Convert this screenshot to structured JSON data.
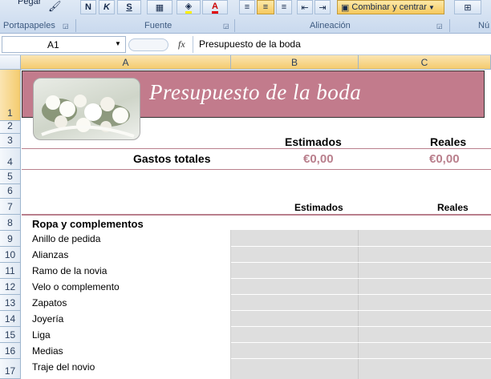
{
  "ribbon": {
    "paste_label": "Pegar",
    "bold": "N",
    "italic": "K",
    "underline": "S",
    "font_color_letter": "A",
    "merge_label": "Combinar y centrar",
    "groups": {
      "clipboard": "Portapapeles",
      "font": "Fuente",
      "alignment": "Alineación",
      "number": "Nú"
    }
  },
  "formula_bar": {
    "cell_ref": "A1",
    "fx": "fx",
    "content": "Presupuesto de la boda"
  },
  "columns": [
    "A",
    "B",
    "C"
  ],
  "rows": [
    "1",
    "2",
    "3",
    "4",
    "5",
    "6",
    "7",
    "8",
    "9",
    "10",
    "11",
    "12",
    "13",
    "14",
    "15",
    "16",
    "17"
  ],
  "sheet": {
    "title": "Presupuesto de la boda",
    "summary_header_est": "Estimados",
    "summary_header_real": "Reales",
    "total_label": "Gastos totales",
    "total_est": "€0,00",
    "total_real": "€0,00",
    "detail_header_est": "Estimados",
    "detail_header_real": "Reales",
    "section_title": "Ropa y complementos",
    "items": [
      "Anillo de pedida",
      "Alianzas",
      "Ramo de la novia",
      "Velo o complemento",
      "Zapatos",
      "Joyería",
      "Liga",
      "Medias",
      "Traje del novio"
    ]
  },
  "colors": {
    "banner": "#c27b8c",
    "accent": "#b97f8c",
    "grid_fill": "#dedede"
  }
}
